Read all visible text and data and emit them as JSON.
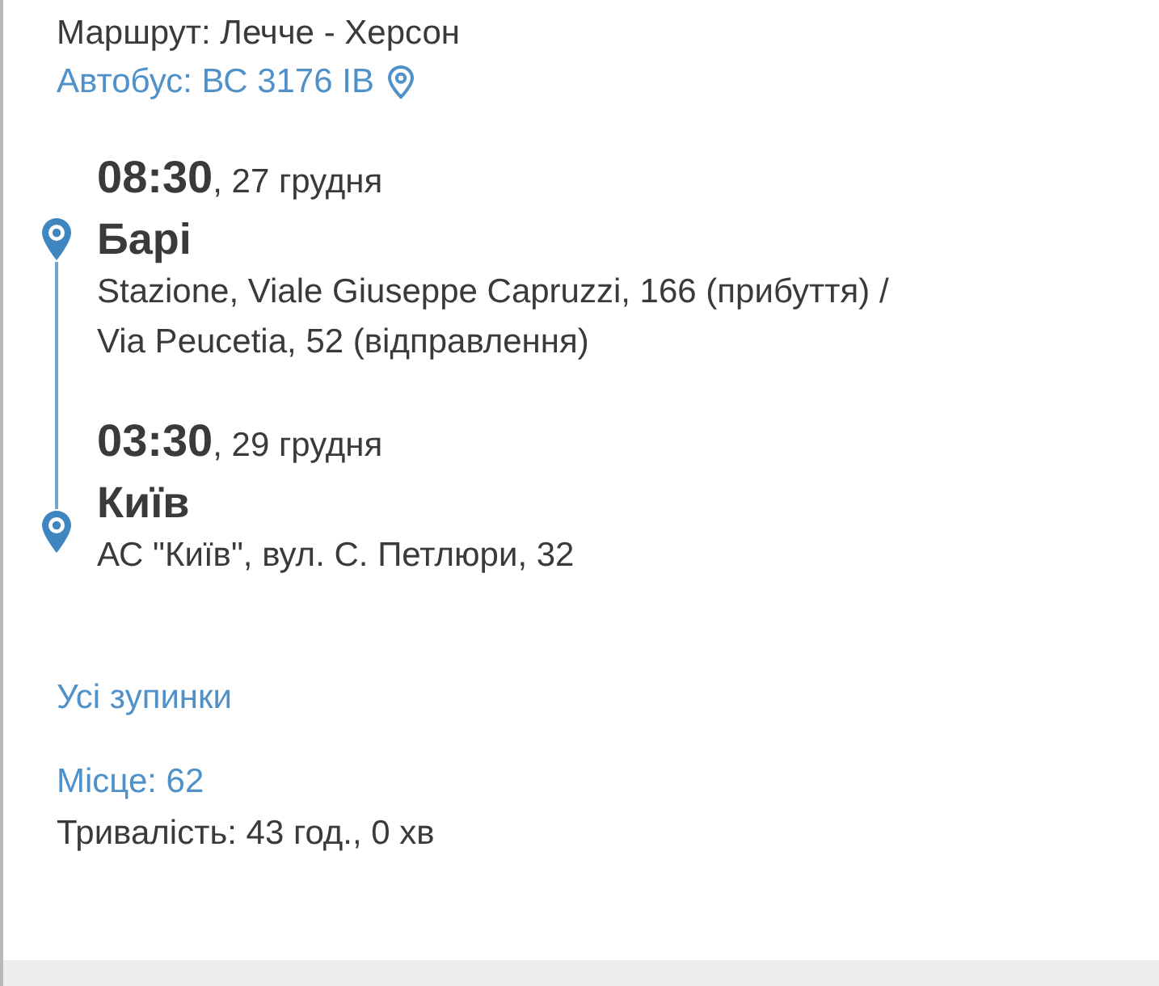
{
  "route": "Маршрут: Лечче - Херсон",
  "bus": {
    "label": "Автобус: ВС 3176 ІВ"
  },
  "stops": [
    {
      "time": "08:30",
      "date": ", 27 грудня",
      "city": "Барі",
      "address_lines": [
        "Stazione, Viale Giuseppe Capruzzi, 166 (прибуття) /",
        "Via Peucetia, 52 (відправлення)"
      ]
    },
    {
      "time": "03:30",
      "date": ", 29 грудня",
      "city": "Київ",
      "address_lines": [
        "АС \"Київ\", вул. С. Петлюри, 32"
      ]
    }
  ],
  "all_stops_link": "Усі зупинки",
  "seat": "Місце: 62",
  "duration": "Тривалість: 43 год., 0 хв"
}
